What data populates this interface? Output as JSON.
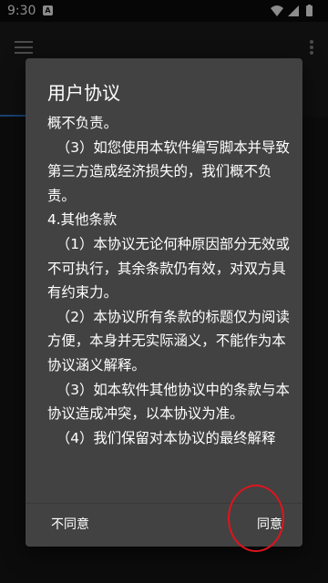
{
  "status_bar": {
    "time": "9:30",
    "notification_glyph": "A"
  },
  "app_bar": {
    "menu_icon": "hamburger-menu-icon",
    "overflow_icon": "more-vert-icon"
  },
  "dialog": {
    "title": "用户协议",
    "paragraphs": [
      "概不负责。",
      "  （3）如您使用本软件编写脚本并导致第三方造成经济损失的，我们概不负责。",
      "",
      "4.其他条款",
      "  （1）本协议无论何种原因部分无效或不可执行，其余条款仍有效，对双方具有约束力。",
      "  （2）本协议所有条款的标题仅为阅读方便，本身并无实际涵义，不能作为本协议涵义解释。",
      "  （3）如本软件其他协议中的条款与本协议造成冲突，以本协议为准。",
      "  （4）我们保留对本协议的最终解释"
    ],
    "disagree_label": "不同意",
    "agree_label": "同意"
  },
  "colors": {
    "dialog_bg": "#424242",
    "accent_tab": "#2f7bd6",
    "highlight_circle": "#e0141e"
  }
}
